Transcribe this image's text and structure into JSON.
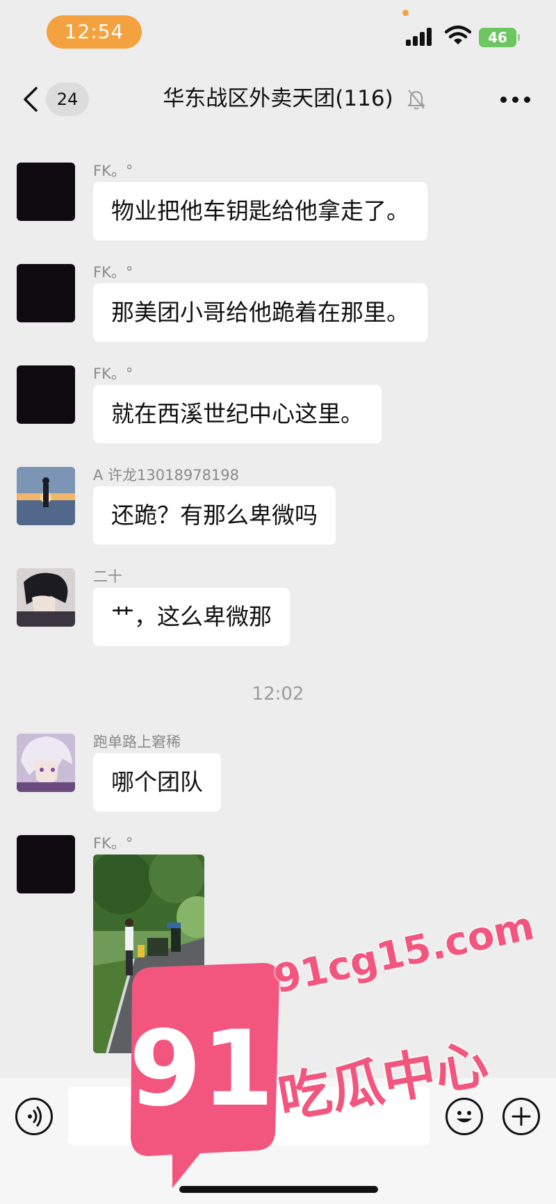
{
  "status_bar": {
    "time": "12:54",
    "battery": "46",
    "accent_color": "#f3a23f",
    "battery_color": "#6cc760"
  },
  "nav": {
    "unread_count": "24",
    "title": "华东战区外卖天团(116)"
  },
  "chat": {
    "messages": [
      {
        "sender": "FK。°",
        "text": "物业把他车钥匙给他拿走了。",
        "avatar": "black-square"
      },
      {
        "sender": "FK。°",
        "text": "那美团小哥给他跪着在那里。",
        "avatar": "black-square"
      },
      {
        "sender": "FK。°",
        "text": "就在西溪世纪中心这里。",
        "avatar": "black-square"
      },
      {
        "sender": "A 许龙13018978198",
        "text": "还跪？有那么卑微吗",
        "avatar": "sunset-silhouette"
      },
      {
        "sender": "二十",
        "text": "艹，这么卑微那",
        "avatar": "anime-dark-hair"
      }
    ],
    "timestamp": "12:02",
    "messages_after": [
      {
        "sender": "跑单路上窘稀",
        "text": "哪个团队",
        "avatar": "anime-silver-hair"
      },
      {
        "sender": "FK。°",
        "image": "street-photo",
        "avatar": "black-square"
      }
    ]
  },
  "watermark": {
    "number": "91",
    "domain": "91cg15.com",
    "name": "吃瓜中心",
    "color": "#f2557e"
  }
}
